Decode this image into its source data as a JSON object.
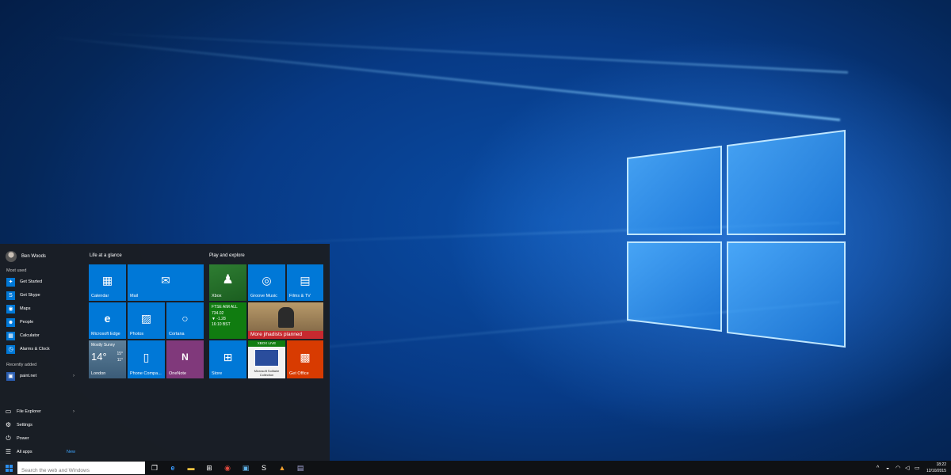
{
  "user": {
    "name": "Ben Woods"
  },
  "sections": {
    "most_used": "Most used",
    "recently_added": "Recently added"
  },
  "most_used": [
    {
      "label": "Get Started",
      "icon": "lightbulb-icon",
      "color": "#0078d7"
    },
    {
      "label": "Get Skype",
      "icon": "skype-icon",
      "color": "#0078d7"
    },
    {
      "label": "Maps",
      "icon": "maps-icon",
      "color": "#0078d7"
    },
    {
      "label": "People",
      "icon": "people-icon",
      "color": "#0078d7"
    },
    {
      "label": "Calculator",
      "icon": "calculator-icon",
      "color": "#0078d7"
    },
    {
      "label": "Alarms & Clock",
      "icon": "alarm-icon",
      "color": "#0078d7"
    }
  ],
  "recently_added": [
    {
      "label": "paint.net",
      "icon": "paintnet-icon"
    }
  ],
  "system": {
    "file_explorer": "File Explorer",
    "settings": "Settings",
    "power": "Power",
    "all_apps": "All apps",
    "new_badge": "New"
  },
  "groups": {
    "life": "Life at a glance",
    "play": "Play and explore"
  },
  "tiles": {
    "calendar": "Calendar",
    "mail": "Mail",
    "edge": "Microsoft Edge",
    "photos": "Photos",
    "cortana": "Cortana",
    "weather_condition": "Mostly Sunny",
    "weather_temp": "14°",
    "weather_hi": "15°",
    "weather_lo": "11°",
    "london": "London",
    "phone": "Phone Compa...",
    "onenote": "OneNote",
    "xbox": "Xbox",
    "groove": "Groove Music",
    "films": "Films & TV",
    "ftse_name": "FTSE AIM ALL",
    "ftse_value": "734.02",
    "ftse_change": "▼ -1.28",
    "ftse_time": "16:10 BST",
    "news": "More jihadists planned",
    "store": "Store",
    "xbox_live": "XBOX LIVE",
    "solitaire": "Microsoft Solitaire Collection",
    "getoffice": "Get Office"
  },
  "colors": {
    "tile_blue": "#0078d7",
    "tile_green": "#107c10",
    "tile_purple": "#80397b",
    "tile_orange": "#d83b01",
    "news_red": "#c7292f",
    "weather_gray": "#4a6e8a"
  },
  "taskbar": {
    "search_placeholder": "Search the web and Windows",
    "time": "18:22",
    "date": "12/10/2015"
  }
}
